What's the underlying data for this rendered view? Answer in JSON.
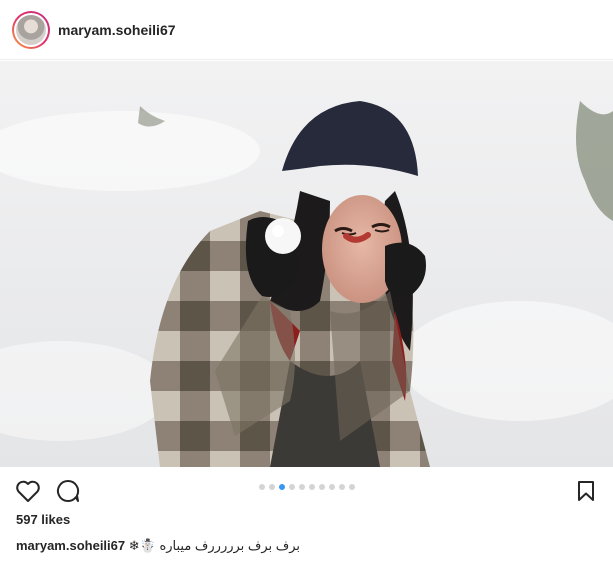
{
  "post": {
    "username": "maryam.soheili67",
    "likes_text": "597 likes",
    "caption_username": "maryam.soheili67",
    "caption_text": "برف برف برررررف میباره ☃️❄"
  },
  "carousel": {
    "total": 10,
    "active_index": 2
  },
  "icons": {
    "like": "heart-icon",
    "comment": "comment-icon",
    "save": "bookmark-icon"
  },
  "colors": {
    "carousel_active": "#3897f0",
    "carousel_inactive": "#d4d4d4",
    "text": "#262626"
  }
}
